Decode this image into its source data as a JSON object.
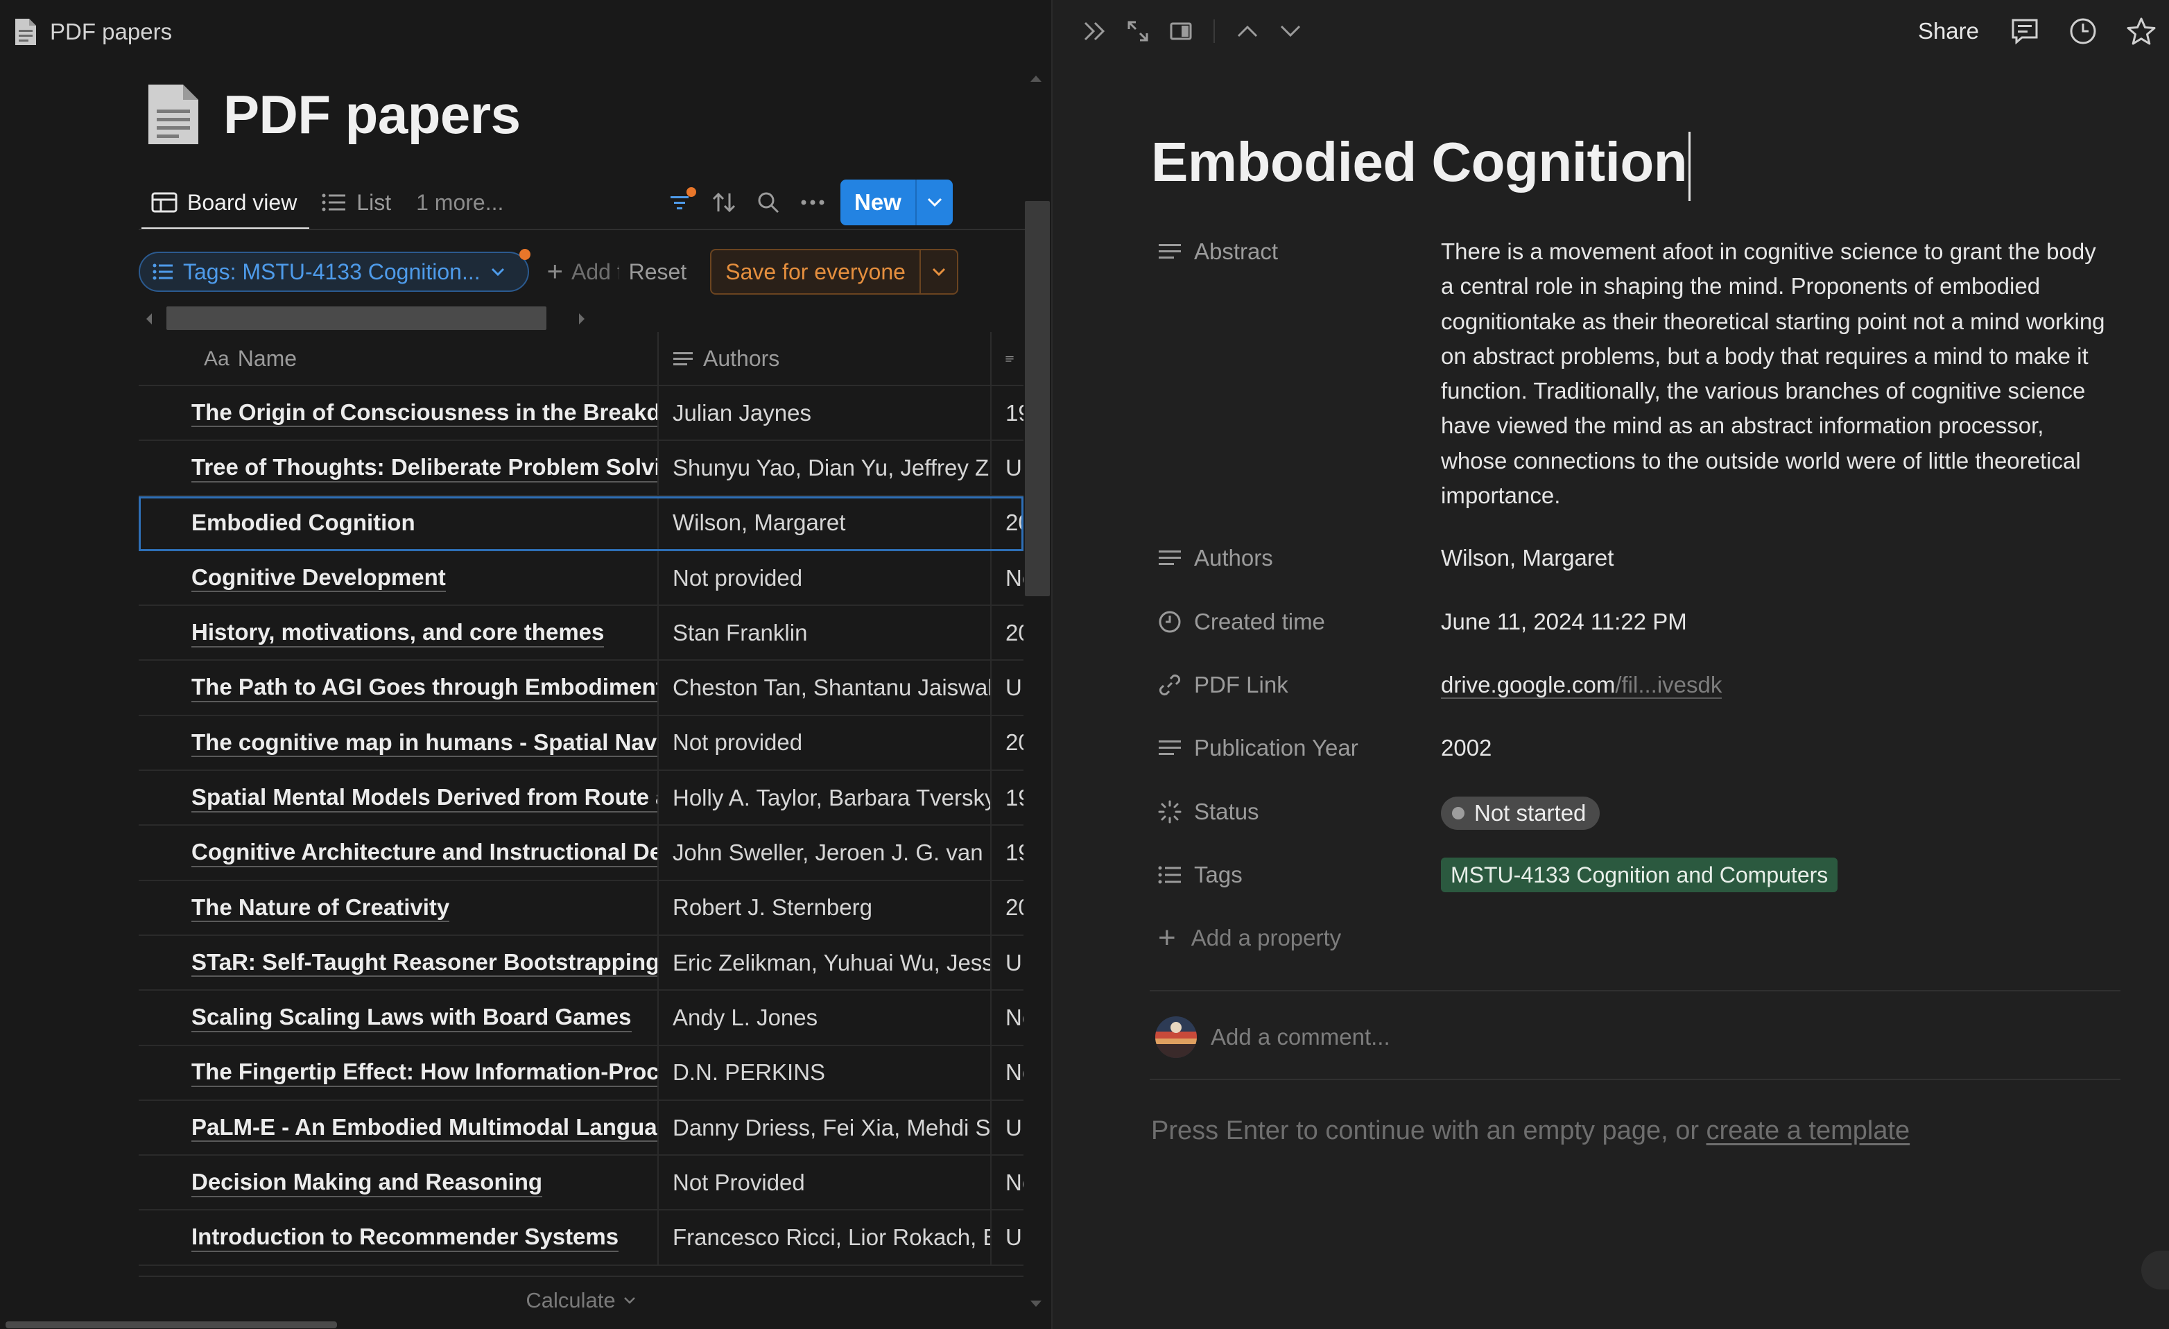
{
  "breadcrumb": {
    "title": "PDF papers"
  },
  "page": {
    "title": "PDF papers"
  },
  "views": {
    "tabs": [
      {
        "label": "Board view",
        "icon": "table-icon",
        "active": true
      },
      {
        "label": "List",
        "icon": "list-icon",
        "active": false
      }
    ],
    "more_label": "1 more...",
    "new_label": "New"
  },
  "filters": {
    "chip_label": "Tags: MSTU-4133 Cognition...",
    "add_label": "Add filter",
    "reset_label": "Reset",
    "save_label": "Save for everyone"
  },
  "table": {
    "columns": {
      "name": "Name",
      "name_prefix": "Aa",
      "authors": "Authors"
    },
    "rows": [
      {
        "name": "The Origin of Consciousness in the Breakdown of the Bicameral Mind",
        "authors": "Julian Jaynes",
        "year": "19"
      },
      {
        "name": "Tree of Thoughts: Deliberate Problem Solving with Large Language Models",
        "authors": "Shunyu Yao, Dian Yu, Jeffrey Zhao",
        "year": "Ur"
      },
      {
        "name": "Embodied Cognition",
        "authors": "Wilson, Margaret",
        "year": "20"
      },
      {
        "name": "Cognitive Development",
        "authors": "Not provided",
        "year": "No"
      },
      {
        "name": "History, motivations, and core themes",
        "authors": "Stan Franklin",
        "year": "20"
      },
      {
        "name": "The Path to AGI Goes through Embodiment",
        "authors": "Cheston Tan, Shantanu Jaiswal",
        "year": "Ur"
      },
      {
        "name": "The cognitive map in humans - Spatial Navigation",
        "authors": "Not provided",
        "year": "20"
      },
      {
        "name": "Spatial Mental Models Derived from Route and Survey",
        "authors": "Holly A. Taylor, Barbara Tversky",
        "year": "19"
      },
      {
        "name": "Cognitive Architecture and Instructional Design",
        "authors": "John Sweller, Jeroen J. G. van Merrienboer",
        "year": "19"
      },
      {
        "name": "The Nature of Creativity",
        "authors": "Robert J. Sternberg",
        "year": "20"
      },
      {
        "name": "STaR: Self-Taught Reasoner Bootstrapping Reasoning",
        "authors": "Eric Zelikman, Yuhuai Wu, Jesse Mu",
        "year": "Ur"
      },
      {
        "name": "Scaling Scaling Laws with Board Games",
        "authors": "Andy L. Jones",
        "year": "No"
      },
      {
        "name": "The Fingertip Effect: How Information-Processing",
        "authors": "D.N. PERKINS",
        "year": "No"
      },
      {
        "name": "PaLM-E - An Embodied Multimodal Language Model",
        "authors": "Danny Driess, Fei Xia, Mehdi S. M.",
        "year": "Ur"
      },
      {
        "name": "Decision Making and Reasoning",
        "authors": "Not Provided",
        "year": "No"
      },
      {
        "name": "Introduction to Recommender Systems",
        "authors": "Francesco Ricci, Lior Rokach, Bracha",
        "year": "Ur"
      }
    ],
    "calculate_label": "Calculate"
  },
  "detail": {
    "toolbar": {
      "share_label": "Share"
    },
    "title": "Embodied Cognition",
    "properties": {
      "abstract": {
        "label": "Abstract",
        "value": "There is a movement afoot in cognitive science to grant the body a central role in shaping the mind. Proponents of embodied cognitiontake as their theoretical starting point not a mind working on abstract problems, but a body that requires a mind to make it function. Traditionally, the various branches of cognitive science have viewed the mind as an abstract information processor, whose connections to the outside world were of little theoretical importance."
      },
      "authors": {
        "label": "Authors",
        "value": "Wilson, Margaret"
      },
      "created": {
        "label": "Created time",
        "value": "June 11, 2024 11:22 PM"
      },
      "pdf_link": {
        "label": "PDF Link",
        "host": "drive.google.com",
        "path": "/fil...ivesdk"
      },
      "year": {
        "label": "Publication Year",
        "value": "2002"
      },
      "status": {
        "label": "Status",
        "value": "Not started"
      },
      "tags": {
        "label": "Tags",
        "value": "MSTU-4133 Cognition and Computers"
      }
    },
    "add_property_label": "Add a property",
    "comment_placeholder": "Add a comment...",
    "hint_text": "Press Enter to continue with an empty page, or ",
    "hint_link": "create a template"
  },
  "colors": {
    "accent_blue": "#2383e2",
    "filter_blue": "#4e9bea",
    "save_orange": "#e58f3e",
    "tag_green": "#2b593f",
    "status_gray": "#4a4a4a",
    "background": "#191919",
    "panel": "#202020"
  }
}
